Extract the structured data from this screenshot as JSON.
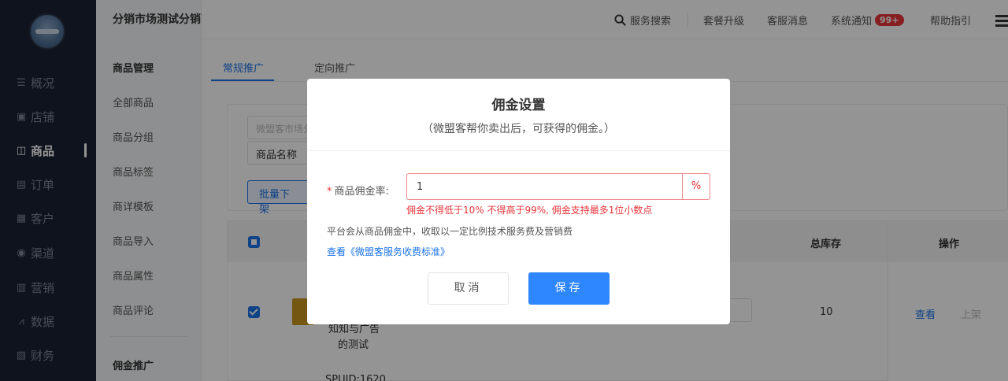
{
  "nav": {
    "items": [
      {
        "icon": "list-icon",
        "glyph": "☰",
        "label": "概况"
      },
      {
        "icon": "store-icon",
        "glyph": "▣",
        "label": "店铺"
      },
      {
        "icon": "goods-icon",
        "glyph": "◫",
        "label": "商品"
      },
      {
        "icon": "order-icon",
        "glyph": "▤",
        "label": "订单"
      },
      {
        "icon": "customer-icon",
        "glyph": "▦",
        "label": "客户"
      },
      {
        "icon": "channel-icon",
        "glyph": "◉",
        "label": "渠道"
      },
      {
        "icon": "marketing-icon",
        "glyph": "▥",
        "label": "营销"
      },
      {
        "icon": "data-icon",
        "glyph": "⩘",
        "label": "数据"
      },
      {
        "icon": "finance-icon",
        "glyph": "▧",
        "label": "财务"
      }
    ]
  },
  "subnav": {
    "brand": "分销市场测试分销商",
    "items": [
      {
        "label": "商品管理",
        "head": true
      },
      {
        "label": "全部商品"
      },
      {
        "label": "商品分组"
      },
      {
        "label": "商品标签"
      },
      {
        "label": "商详模板"
      },
      {
        "label": "商品导入"
      },
      {
        "label": "商品属性"
      },
      {
        "label": "商品评论"
      },
      {
        "label": "佣金推广",
        "head": true
      }
    ]
  },
  "header": {
    "search_label": "服务搜索",
    "upgrade_label": "套餐升级",
    "service_msg_label": "客服消息",
    "system_notice_label": "系统通知",
    "notice_badge": "99+",
    "help_label": "帮助指引"
  },
  "main": {
    "tabs": [
      "常规推广",
      "定向推广"
    ],
    "filter": {
      "source_placeholder": "微盟客市场分",
      "name_label": "商品名称",
      "batch_offline_label": "批量下架"
    },
    "table": {
      "stock_header": "总库存",
      "ops_header": "操作",
      "row": {
        "name_line1": "知知与广告",
        "name_line2": "的测试",
        "stock": "10",
        "view_label": "查看",
        "online_label": "上架"
      },
      "next_row_spuid": "SPUID:1620"
    }
  },
  "dialog": {
    "title": "佣金设置",
    "subtitle": "（微盟客帮你卖出后，可获得的佣金。）",
    "rate_label": "商品佣金率:",
    "required_mark": "*",
    "rate_value": "1",
    "rate_unit": "%",
    "error_text": "佣金不得低于10% 不得高于99%, 佣金支持最多1位小数点",
    "note_text": "平台会从商品佣金中，收取以一定比例技术服务费及营销费",
    "standard_link": "查看《微盟客服务收费标准》",
    "cancel_label": "取消",
    "save_label": "保存"
  },
  "colors": {
    "accent": "#2f87ff",
    "error": "#e8353b",
    "nav_bg": "#1b2233"
  }
}
